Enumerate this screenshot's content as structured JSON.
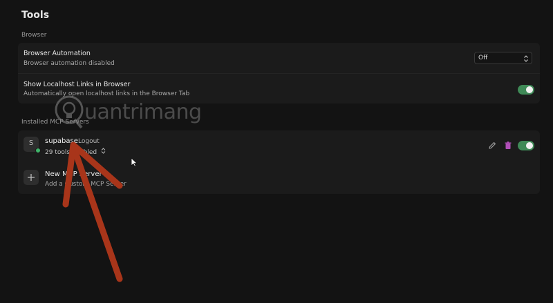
{
  "page": {
    "title": "Tools"
  },
  "browser_section": {
    "label": "Browser",
    "automation": {
      "title": "Browser Automation",
      "description": "Browser automation disabled",
      "select_value": "Off"
    },
    "localhost": {
      "title": "Show Localhost Links in Browser",
      "description": "Automatically open localhost links in the Browser Tab",
      "enabled": true
    }
  },
  "mcp_section": {
    "label": "Installed MCP Servers",
    "server": {
      "avatar_letter": "S",
      "name": "supabase",
      "logout_label": "Logout",
      "tools_text": "29 tools enabled",
      "enabled": true
    },
    "new_server": {
      "title": "New MCP Server",
      "description": "Add a Custom MCP Server"
    }
  },
  "watermark": {
    "text": "uantrimang"
  },
  "colors": {
    "background": "#131313",
    "card": "#1b1b1b",
    "toggle_on": "#3f8a57",
    "status_online": "#3fb56a",
    "delete_icon": "#b14fb8",
    "arrow": "#a8351a"
  }
}
